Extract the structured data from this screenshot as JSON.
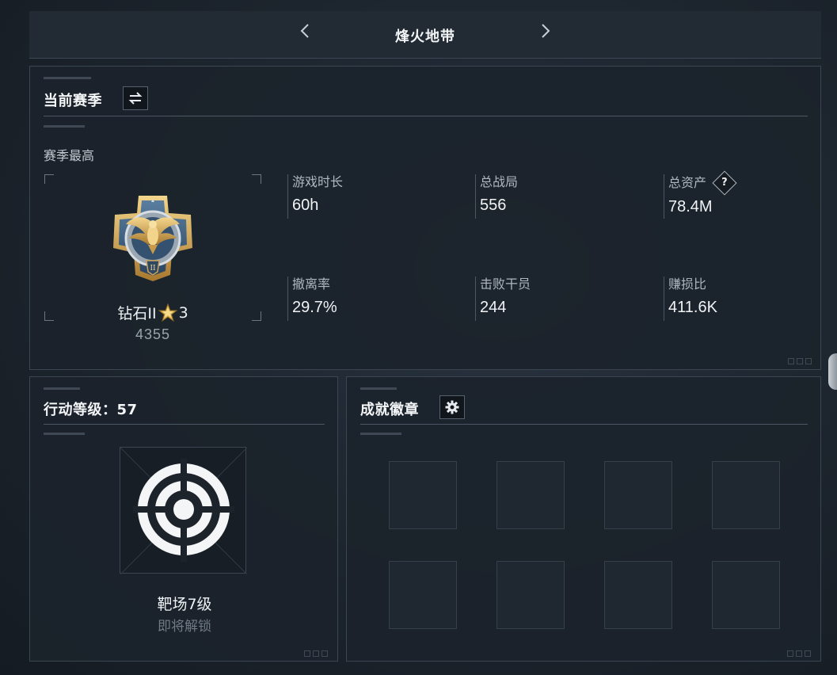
{
  "header": {
    "title": "烽火地带",
    "prev_icon": "chevron-left-icon",
    "next_icon": "chevron-right-icon"
  },
  "season": {
    "title": "当前赛季",
    "switch_icon": "switch-arrows-icon",
    "subheading": "赛季最高",
    "rank": {
      "name": "钻石II",
      "stars": "3",
      "score": "4355",
      "emblem_icon": "eagle-rank-emblem-icon"
    },
    "stats": {
      "play_time": {
        "label": "游戏时长",
        "value": "60h"
      },
      "total_matches": {
        "label": "总战局",
        "value": "556"
      },
      "total_assets": {
        "label": "总资产",
        "value": "78.4M"
      },
      "extraction_rate": {
        "label": "撤离率",
        "value": "29.7%"
      },
      "operators_defeated": {
        "label": "击败干员",
        "value": "244"
      },
      "profit_ratio": {
        "label": "赚损比",
        "value": "411.6K"
      }
    }
  },
  "action_level": {
    "title": "行动等级：57",
    "target_icon": "target-icon",
    "name": "靶场7级",
    "status": "即将解锁"
  },
  "achievements": {
    "title": "成就徽章",
    "settings_icon": "gear-icon",
    "slot_count": 8
  },
  "colors": {
    "background": "#1c242d",
    "panel": "#1b232b",
    "border": "#3a4652",
    "text_primary": "#f1f3f5",
    "text_secondary": "#aeb7c0",
    "gold": "#d9b25c"
  }
}
